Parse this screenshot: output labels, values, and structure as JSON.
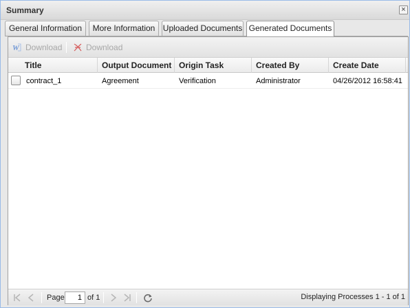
{
  "window": {
    "title": "Summary",
    "close_symbol": "×"
  },
  "tabs": [
    {
      "label": "General Information"
    },
    {
      "label": "More Information"
    },
    {
      "label": "Uploaded Documents"
    },
    {
      "label": "Generated Documents",
      "active": true
    }
  ],
  "toolbar": {
    "word_download_label": "Download",
    "word_icon": "word-doc-icon",
    "pdf_download_label": "Download",
    "pdf_icon": "pdf-doc-icon"
  },
  "grid": {
    "columns": [
      "Title",
      "Output Document",
      "Origin Task",
      "Created By",
      "Create Date"
    ],
    "rows": [
      {
        "title": "contract_1",
        "output_document": "Agreement",
        "origin_task": "Verification",
        "created_by": "Administrator",
        "create_date": "04/26/2012 16:58:41"
      }
    ]
  },
  "pager": {
    "page_label": "Page",
    "page_value": "1",
    "of_label": "of 1",
    "status": "Displaying Processes 1 - 1 of 1"
  },
  "colors": {
    "window_border": "#99bbe8",
    "toolbar_disabled_text": "#a8a8a8",
    "pdf_red": "#d02020",
    "word_blue": "#4a7fd0"
  }
}
